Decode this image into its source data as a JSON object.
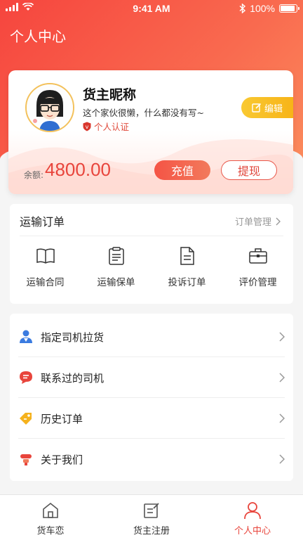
{
  "status_bar": {
    "time": "9:41 AM",
    "battery": "100%"
  },
  "header": {
    "title": "个人中心"
  },
  "profile": {
    "nickname": "货主昵称",
    "bio": "这个家伙很懒，什么都没有写~",
    "verify_label": "个人认证",
    "edit_label": "编辑",
    "balance_label": "余额:",
    "balance_value": "4800.00",
    "recharge_label": "充值",
    "withdraw_label": "提现"
  },
  "orders": {
    "title": "运输订单",
    "manage_label": "订单管理",
    "items": [
      {
        "label": "运输合同",
        "icon": "book-icon"
      },
      {
        "label": "运输保单",
        "icon": "clipboard-icon"
      },
      {
        "label": "投诉订单",
        "icon": "document-icon"
      },
      {
        "label": "评价管理",
        "icon": "briefcase-icon"
      }
    ]
  },
  "menu": {
    "items": [
      {
        "label": "指定司机拉货",
        "icon": "driver-icon"
      },
      {
        "label": "联系过的司机",
        "icon": "chat-icon"
      },
      {
        "label": "历史订单",
        "icon": "tag-icon"
      },
      {
        "label": "关于我们",
        "icon": "info-icon"
      }
    ]
  },
  "tabbar": {
    "tabs": [
      {
        "label": "货车恋",
        "icon": "home-icon"
      },
      {
        "label": "货主注册",
        "icon": "register-icon"
      },
      {
        "label": "个人中心",
        "icon": "user-icon",
        "active": true
      }
    ]
  },
  "colors": {
    "accent": "#e8453c",
    "edit_button": "#f7b418",
    "menu_blue": "#3a7be0",
    "menu_red": "#e8453c",
    "menu_yellow": "#f5b21d"
  }
}
